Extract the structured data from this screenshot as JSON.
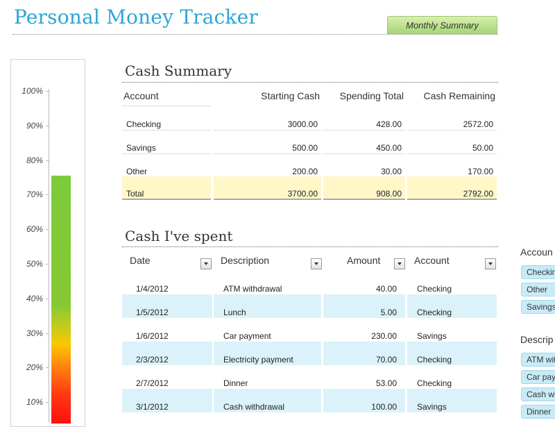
{
  "app": {
    "title": "Personal Money Tracker",
    "summary_button": "Monthly Summary"
  },
  "gauge": {
    "labels": [
      "100%",
      "90%",
      "80%",
      "70%",
      "60%",
      "50%",
      "40%",
      "30%",
      "20%",
      "10%"
    ],
    "value_percent": 75.5,
    "colors": [
      "#ff1010",
      "#ff8a10",
      "#f9c800",
      "#86c833"
    ]
  },
  "cash_summary": {
    "title": "Cash Summary",
    "headers": [
      "Account",
      "Starting Cash",
      "Spending Total",
      "Cash Remaining"
    ],
    "rows": [
      [
        "Checking",
        "3000.00",
        "428.00",
        "2572.00"
      ],
      [
        "Savings",
        "500.00",
        "450.00",
        "50.00"
      ],
      [
        "Other",
        "200.00",
        "30.00",
        "170.00"
      ]
    ],
    "total": [
      "Total",
      "3700.00",
      "908.00",
      "2792.00"
    ],
    "total_color": "#fff7c8"
  },
  "spent": {
    "title": "Cash I've spent",
    "headers": [
      "Date",
      "Description",
      "Amount",
      "Account"
    ],
    "rows": [
      [
        "1/4/2012",
        "ATM withdrawal",
        "40.00",
        "Checking"
      ],
      [
        "1/5/2012",
        "Lunch",
        "5.00",
        "Checking"
      ],
      [
        "1/6/2012",
        "Car payment",
        "230.00",
        "Savings"
      ],
      [
        "2/3/2012",
        "Electricity payment",
        "70.00",
        "Checking"
      ],
      [
        "2/7/2012",
        "Dinner",
        "53.00",
        "Checking"
      ],
      [
        "3/1/2012",
        "Cash withdrawal",
        "100.00",
        "Savings"
      ]
    ],
    "stripe_color": "#dcf2fa"
  },
  "slicers": {
    "account": {
      "title": "Accoun",
      "items": [
        "Checkin",
        "Other",
        "Savings"
      ]
    },
    "description": {
      "title": "Descrip",
      "items": [
        "ATM wit",
        "Car pay",
        "Cash wi",
        "Dinner"
      ]
    }
  }
}
